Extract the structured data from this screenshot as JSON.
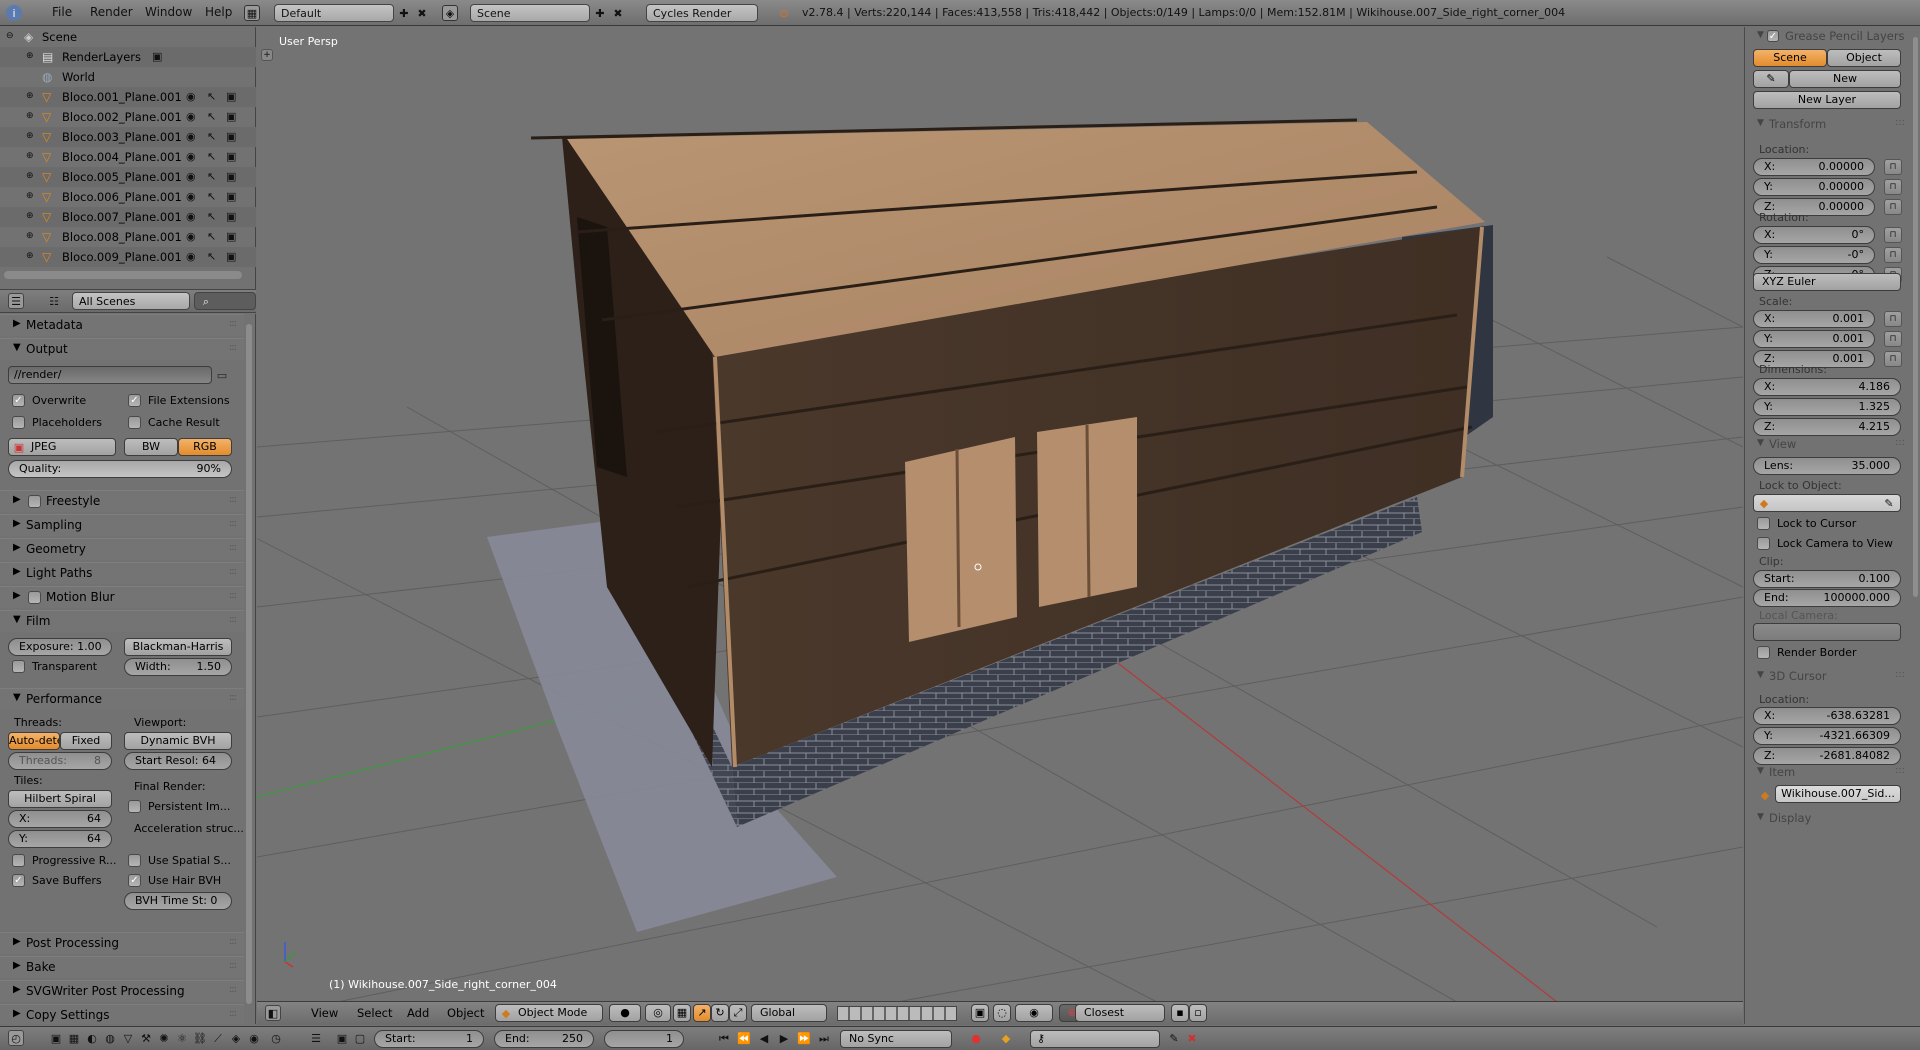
{
  "topbar": {
    "menus": [
      "File",
      "Render",
      "Window",
      "Help"
    ],
    "screen_layout": "Default",
    "scene": "Scene",
    "render_engine": "Cycles Render",
    "stats": "v2.78.4 | Verts:220,144 | Faces:413,558 | Tris:418,442 | Objects:0/149 | Lamps:0/0 | Mem:152.81M | Wikihouse.007_Side_right_corner_004"
  },
  "outliner": {
    "scene": "Scene",
    "render_layers": "RenderLayers",
    "world": "World",
    "objects": [
      "Bloco.001_Plane.001",
      "Bloco.002_Plane.001",
      "Bloco.003_Plane.001",
      "Bloco.004_Plane.001",
      "Bloco.005_Plane.001",
      "Bloco.006_Plane.001",
      "Bloco.007_Plane.001",
      "Bloco.008_Plane.001",
      "Bloco.009_Plane.001"
    ],
    "filter": "All Scenes"
  },
  "properties": {
    "metadata": "Metadata",
    "output": "Output",
    "output_path": "//render/",
    "overwrite": "Overwrite",
    "file_extensions": "File Extensions",
    "placeholders": "Placeholders",
    "cache_result": "Cache Result",
    "format": "JPEG",
    "bw": "BW",
    "rgb": "RGB",
    "quality_label": "Quality:",
    "quality_value": "90%",
    "freestyle": "Freestyle",
    "sampling": "Sampling",
    "geometry": "Geometry",
    "light_paths": "Light Paths",
    "motion_blur": "Motion Blur",
    "film": "Film",
    "exposure": "Exposure: 1.00",
    "filter_type": "Blackman-Harris",
    "transparent": "Transparent",
    "width": "Width:",
    "width_value": "1.50",
    "performance": "Performance",
    "threads_label": "Threads:",
    "auto_detect": "Auto-dete",
    "fixed": "Fixed",
    "threads_count_label": "Threads:",
    "threads_count": "8",
    "viewport_label": "Viewport:",
    "viewport_bvh": "Dynamic BVH",
    "start_resol": "Start Resol:  64",
    "tiles_label": "Tiles:",
    "tile_order": "Hilbert Spiral",
    "tile_x_label": "X:",
    "tile_x": "64",
    "tile_y_label": "Y:",
    "tile_y": "64",
    "final_render": "Final Render:",
    "persistent": "Persistent Im...",
    "accel": "Acceleration struc...",
    "progressive": "Progressive R...",
    "use_spatial": "Use Spatial S...",
    "save_buffers": "Save Buffers",
    "use_hair": "Use Hair BVH",
    "bvh_time": "BVH Time St: 0",
    "post_processing": "Post Processing",
    "bake": "Bake",
    "svgwriter": "SVGWriter Post Processing",
    "copy_settings": "Copy Settings"
  },
  "viewport": {
    "view_name": "User Persp",
    "object_label": "(1) Wikihouse.007_Side_right_corner_004"
  },
  "npanel": {
    "grease_pencil": "Grease Pencil Layers",
    "scene_tab": "Scene",
    "object_tab": "Object",
    "new": "New",
    "new_layer": "New Layer",
    "transform": "Transform",
    "location": "Location:",
    "loc": [
      [
        "X:",
        "0.00000"
      ],
      [
        "Y:",
        "0.00000"
      ],
      [
        "Z:",
        "0.00000"
      ]
    ],
    "rotation": "Rotation:",
    "rot": [
      [
        "X:",
        "0°"
      ],
      [
        "Y:",
        "-0°"
      ],
      [
        "Z:",
        "0°"
      ]
    ],
    "rotation_mode": "XYZ Euler",
    "scale": "Scale:",
    "scl": [
      [
        "X:",
        "0.001"
      ],
      [
        "Y:",
        "0.001"
      ],
      [
        "Z:",
        "0.001"
      ]
    ],
    "dimensions": "Dimensions:",
    "dim": [
      [
        "X:",
        "4.186"
      ],
      [
        "Y:",
        "1.325"
      ],
      [
        "Z:",
        "4.215"
      ]
    ],
    "view": "View",
    "lens_label": "Lens:",
    "lens": "35.000",
    "lock_to_object": "Lock to Object:",
    "lock_to_cursor": "Lock to Cursor",
    "lock_camera": "Lock Camera to View",
    "clip": "Clip:",
    "clip_start_label": "Start:",
    "clip_start": "0.100",
    "clip_end_label": "End:",
    "clip_end": "100000.000",
    "local_camera": "Local Camera:",
    "render_border": "Render Border",
    "cursor_3d": "3D Cursor",
    "cursor_location": "Location:",
    "cur": [
      [
        "X:",
        "-638.63281"
      ],
      [
        "Y:",
        "-4321.66309"
      ],
      [
        "Z:",
        "-2681.84082"
      ]
    ],
    "item": "Item",
    "item_name": "Wikihouse.007_Sid...",
    "display": "Display"
  },
  "vp_header": {
    "menus": [
      "View",
      "Select",
      "Add",
      "Object"
    ],
    "mode": "Object Mode",
    "orientation": "Global",
    "snap": "Closest"
  },
  "timeline": {
    "start_label": "Start:",
    "start": "1",
    "end_label": "End:",
    "end": "250",
    "current": "1",
    "sync": "No Sync"
  },
  "colors": {
    "accent": "#e38c2c",
    "panel": "#727272",
    "wall": "#4b3a2c",
    "roof": "#b08c6a",
    "brick": "#3c404c"
  }
}
